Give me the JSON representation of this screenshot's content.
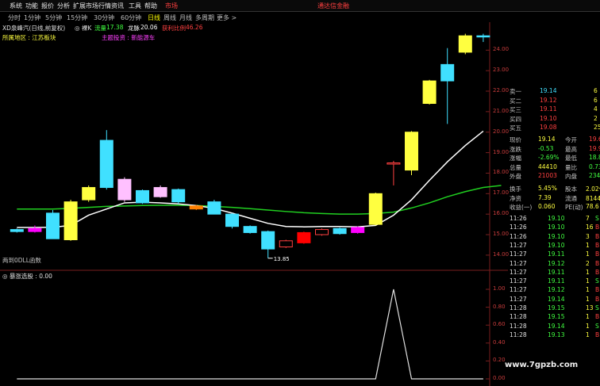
{
  "menu": {
    "items": [
      "系统",
      "功能",
      "报价",
      "分析",
      "扩展市场行情",
      "资讯",
      "工具",
      "帮助"
    ],
    "market_label": "市场",
    "right_label": "通达信金融"
  },
  "toolbar": {
    "items": [
      "分时",
      "1分钟",
      "5分钟",
      "15分钟",
      "30分钟",
      "60分钟",
      "日线",
      "周线",
      "月线",
      "多周期",
      "更多 >"
    ],
    "active": "日线"
  },
  "header": {
    "stock_name": "XD泉峰汽(日线,前复权)",
    "ma_label": "◎ 裸K",
    "volume_label": "流量",
    "volume_value": "17.38",
    "dragon_label": "龙脉",
    "dragon_value": "20.06",
    "profit_label": "获利比例",
    "profit_value": "46.26",
    "region_label": "所属地区 : 江苏板块",
    "theme_label": "主题投资 : 新能源车"
  },
  "chart_data": {
    "type": "candlestick",
    "y_ticks": [
      "24.00",
      "23.00",
      "22.00",
      "21.00",
      "20.00",
      "19.00",
      "18.00",
      "17.00",
      "16.00",
      "15.00",
      "14.00"
    ],
    "ylim": [
      13.3,
      24.9
    ],
    "candles": [
      {
        "o": 15.25,
        "c": 15.15,
        "h": 15.3,
        "l": 15.1,
        "color": "#40e0ff"
      },
      {
        "o": 15.3,
        "c": 15.15,
        "h": 15.45,
        "l": 15.1,
        "color": "#ff00ff"
      },
      {
        "o": 14.8,
        "c": 16.05,
        "h": 16.2,
        "l": 14.8,
        "color": "#40e0ff"
      },
      {
        "o": 14.75,
        "c": 16.6,
        "h": 16.7,
        "l": 14.7,
        "color": "#ffff40"
      },
      {
        "o": 16.7,
        "c": 17.3,
        "h": 17.4,
        "l": 16.6,
        "color": "#ffff40"
      },
      {
        "o": 19.6,
        "c": 17.3,
        "h": 20.1,
        "l": 17.2,
        "color": "#40e0ff"
      },
      {
        "o": 17.7,
        "c": 16.7,
        "h": 17.8,
        "l": 16.6,
        "color": "#ffc0ff"
      },
      {
        "o": 17.15,
        "c": 16.55,
        "h": 17.2,
        "l": 16.5,
        "color": "#40e0ff"
      },
      {
        "o": 17.3,
        "c": 16.85,
        "h": 17.4,
        "l": 16.8,
        "color": "#ffc0ff"
      },
      {
        "o": 17.2,
        "c": 16.6,
        "h": 17.25,
        "l": 16.5,
        "color": "#40e0ff"
      },
      {
        "o": 16.4,
        "c": 16.25,
        "h": 16.45,
        "l": 16.2,
        "color": "#ff8000"
      },
      {
        "o": 16.6,
        "c": 16.0,
        "h": 16.7,
        "l": 16.0,
        "color": "#40e0ff"
      },
      {
        "o": 16.0,
        "c": 15.4,
        "h": 16.05,
        "l": 15.3,
        "color": "#40e0ff"
      },
      {
        "o": 15.4,
        "c": 15.1,
        "h": 15.45,
        "l": 15.05,
        "color": "#40e0ff"
      },
      {
        "o": 15.15,
        "c": 14.3,
        "h": 15.2,
        "l": 13.85,
        "color": "#40e0ff"
      },
      {
        "o": 14.4,
        "c": 14.7,
        "h": 14.75,
        "l": 14.35,
        "color": "#ff4040"
      },
      {
        "o": 14.6,
        "c": 15.1,
        "h": 15.15,
        "l": 14.55,
        "color": "#ff0000"
      },
      {
        "o": 15.0,
        "c": 15.25,
        "h": 15.3,
        "l": 14.95,
        "color": "#ff4040"
      },
      {
        "o": 15.3,
        "c": 15.05,
        "h": 15.35,
        "l": 15.0,
        "color": "#40e0ff"
      },
      {
        "o": 15.1,
        "c": 15.35,
        "h": 15.4,
        "l": 15.05,
        "color": "#ff00ff"
      },
      {
        "o": 15.5,
        "c": 17.0,
        "h": 17.05,
        "l": 15.45,
        "color": "#ffff40"
      },
      {
        "o": 18.5,
        "c": 18.5,
        "h": 18.6,
        "l": 17.4,
        "color": "#ff4040"
      },
      {
        "o": 18.15,
        "c": 20.0,
        "h": 20.05,
        "l": 17.9,
        "color": "#ffff40"
      },
      {
        "o": 21.4,
        "c": 22.5,
        "h": 22.55,
        "l": 21.35,
        "color": "#ffff40"
      },
      {
        "o": 23.3,
        "c": 22.5,
        "h": 24.1,
        "l": 20.4,
        "color": "#40e0ff"
      },
      {
        "o": 23.9,
        "c": 24.7,
        "h": 24.8,
        "l": 23.8,
        "color": "#ffff40"
      },
      {
        "o": 24.7,
        "c": 24.7,
        "h": 24.8,
        "l": 24.4,
        "color": "#40e0ff"
      }
    ],
    "ma_white": [
      15.35,
      15.35,
      15.36,
      15.45,
      15.95,
      16.25,
      16.55,
      16.58,
      16.55,
      16.5,
      16.42,
      16.28,
      16.05,
      15.8,
      15.55,
      15.4,
      15.38,
      15.4,
      15.4,
      15.38,
      15.45,
      15.95,
      16.7,
      17.65,
      18.55,
      19.35,
      20.05
    ],
    "ma_green": [
      16.25,
      16.25,
      16.28,
      16.33,
      16.38,
      16.4,
      16.42,
      16.43,
      16.43,
      16.42,
      16.38,
      16.33,
      16.27,
      16.2,
      16.13,
      16.07,
      16.03,
      16.0,
      16.0,
      16.03,
      16.1,
      16.3,
      16.55,
      16.85,
      17.1,
      17.3,
      17.4
    ],
    "low_label": "13.85",
    "bottom_label": "两到0DLL函数"
  },
  "indicator": {
    "title": "◎ 暴涨选股 : 0.00",
    "y_ticks": [
      "1.00",
      "0.80",
      "0.60",
      "0.40",
      "0.20",
      "0.00"
    ],
    "values": [
      0,
      0,
      0,
      0,
      0,
      0,
      0,
      0,
      0,
      0,
      0,
      0,
      0,
      0,
      0,
      0,
      0,
      0,
      0,
      0,
      0,
      1,
      0,
      0,
      0,
      0,
      0
    ]
  },
  "quotes": {
    "order_book": [
      {
        "label": "卖一",
        "value": "19.14",
        "vol": "6",
        "color": "#40e0ff"
      },
      {
        "label": "买二",
        "value": "19.12",
        "vol": "6",
        "color": "#ff4040"
      },
      {
        "label": "买三",
        "value": "19.11",
        "vol": "4",
        "color": "#ff4040"
      },
      {
        "label": "买四",
        "value": "19.10",
        "vol": "2",
        "color": "#ff4040"
      },
      {
        "label": "买五",
        "value": "19.08",
        "vol": "25",
        "color": "#ff4040"
      }
    ],
    "stats": [
      {
        "l1": "现价",
        "v1": "19.14",
        "c1": "#ffff40",
        "l2": "今开",
        "v2": "19.69",
        "c2": "#ff4040"
      },
      {
        "l1": "涨跌",
        "v1": "-0.53",
        "c1": "#40ff40",
        "l2": "最高",
        "v2": "19.93",
        "c2": "#ff4040"
      },
      {
        "l1": "涨幅",
        "v1": "-2.69%",
        "c1": "#40ff40",
        "l2": "最低",
        "v2": "18.81",
        "c2": "#40ff40"
      },
      {
        "l1": "总量",
        "v1": "44410",
        "c1": "#ffff40",
        "l2": "量比",
        "v2": "0.73",
        "c2": "#40ff40"
      },
      {
        "l1": "外盘",
        "v1": "21003",
        "c1": "#ff4040",
        "l2": "内盘",
        "v2": "23407",
        "c2": "#40ff40"
      }
    ],
    "stats2": [
      {
        "l1": "换手",
        "v1": "5.45%",
        "c1": "#ffff40",
        "l2": "股本",
        "v2": "2.02亿",
        "c2": "#ffff40"
      },
      {
        "l1": "净资",
        "v1": "7.39",
        "c1": "#ffff40",
        "l2": "流通",
        "v2": "8144万",
        "c2": "#ffff40"
      },
      {
        "l1": "收益(一)",
        "v1": "0.060",
        "c1": "#ffff40",
        "l2": "PE(动)",
        "v2": "78.6",
        "c2": "#ffff40"
      }
    ],
    "ticks": [
      {
        "t": "11:26",
        "p": "19.10",
        "v": "7",
        "f": "S",
        "c": "#40ff40"
      },
      {
        "t": "11:26",
        "p": "19.10",
        "v": "16",
        "f": "B",
        "c": "#ff4040"
      },
      {
        "t": "11:26",
        "p": "19.10",
        "v": "3",
        "f": "B",
        "c": "#ff4040"
      },
      {
        "t": "11:27",
        "p": "19.10",
        "v": "1",
        "f": "B",
        "c": "#ff4040"
      },
      {
        "t": "11:27",
        "p": "19.11",
        "v": "1",
        "f": "B",
        "c": "#ff4040"
      },
      {
        "t": "11:27",
        "p": "19.12",
        "v": "2",
        "f": "B",
        "c": "#ff4040"
      },
      {
        "t": "11:27",
        "p": "19.11",
        "v": "1",
        "f": "B",
        "c": "#ff4040"
      },
      {
        "t": "11:27",
        "p": "19.11",
        "v": "1",
        "f": "S",
        "c": "#40ff40"
      },
      {
        "t": "11:27",
        "p": "19.12",
        "v": "1",
        "f": "B",
        "c": "#ff4040"
      },
      {
        "t": "11:27",
        "p": "19.14",
        "v": "1",
        "f": "B",
        "c": "#ff4040"
      },
      {
        "t": "11:28",
        "p": "19.15",
        "v": "13",
        "f": "S",
        "c": "#40ff40"
      },
      {
        "t": "11:28",
        "p": "19.15",
        "v": "1",
        "f": "B",
        "c": "#ff4040"
      },
      {
        "t": "11:28",
        "p": "19.14",
        "v": "1",
        "f": "S",
        "c": "#40ff40"
      },
      {
        "t": "11:28",
        "p": "19.13",
        "v": "1",
        "f": "B",
        "c": "#ff4040"
      }
    ]
  },
  "watermark": "www.7gpzb.com"
}
